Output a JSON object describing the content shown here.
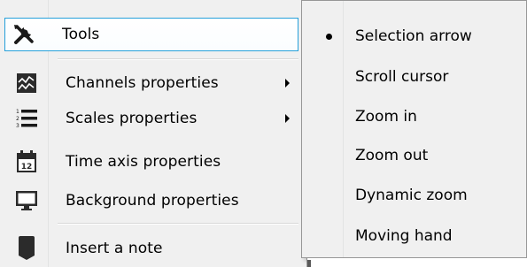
{
  "menu": {
    "items": [
      {
        "label": "Tools",
        "icon": "tools-icon",
        "submenu": false,
        "active": true
      },
      {
        "label": "Channels properties",
        "icon": "channels-icon",
        "submenu": true
      },
      {
        "label": "Scales properties",
        "icon": "scales-list-icon",
        "submenu": true
      },
      {
        "label": "Time axis properties",
        "icon": "calendar-icon",
        "calendar_number": "12",
        "submenu": false
      },
      {
        "label": "Background properties",
        "icon": "monitor-icon",
        "submenu": false
      },
      {
        "label": "Insert a note",
        "icon": "note-tag-icon",
        "submenu": false
      }
    ]
  },
  "submenu": {
    "items": [
      {
        "label": "Selection arrow",
        "selected": true
      },
      {
        "label": "Scroll cursor",
        "selected": false
      },
      {
        "label": "Zoom in",
        "selected": false
      },
      {
        "label": "Zoom out",
        "selected": false
      },
      {
        "label": "Dynamic zoom",
        "selected": false
      },
      {
        "label": "Moving hand",
        "selected": false
      }
    ]
  },
  "colors": {
    "menu_background": "#f0f0f0",
    "highlight_border": "#26a0da",
    "separator": "#d7d7d7"
  }
}
